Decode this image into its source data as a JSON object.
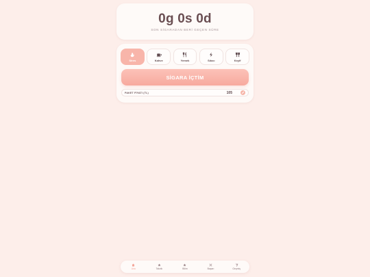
{
  "timer": {
    "value": "0g 0s 0d",
    "caption": "SON SİGARADAN BERİ GEÇEN SÜRE"
  },
  "categories": [
    {
      "label": "Stres",
      "icon": "stress-icon",
      "active": true
    },
    {
      "label": "Kahve",
      "icon": "coffee-icon",
      "active": false
    },
    {
      "label": "Yemek",
      "icon": "food-icon",
      "active": false
    },
    {
      "label": "Sıkıcı",
      "icon": "bored-icon",
      "active": false
    },
    {
      "label": "Keyif",
      "icon": "pleasure-icon",
      "active": false
    }
  ],
  "smoke_button": "SİGARA İÇTİM",
  "price": {
    "label": "PAKET FİYATI (TL)",
    "value": "105"
  },
  "nav": [
    {
      "label": "Ana",
      "icon": "home-icon",
      "active": true
    },
    {
      "label": "Takvik",
      "icon": "calendar-icon",
      "active": false
    },
    {
      "label": "Bilim",
      "icon": "science-icon",
      "active": false
    },
    {
      "label": "Başarı",
      "icon": "trophy-icon",
      "active": false
    },
    {
      "label": "Geçmiş",
      "icon": "history-icon",
      "active": false
    }
  ],
  "colors": {
    "background": "#fdeeea",
    "accent": "#f8b5aa",
    "card": "#fefaf8",
    "text": "#6a4e52"
  }
}
